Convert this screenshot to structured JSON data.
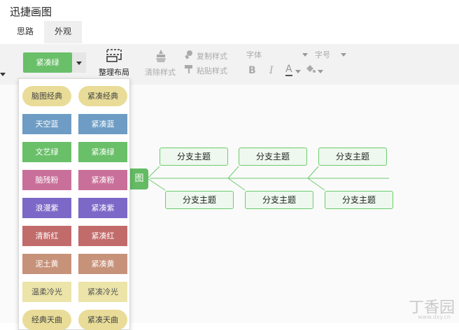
{
  "app_title": "迅捷画图",
  "tabs": [
    {
      "label": "思路"
    },
    {
      "label": "外观"
    }
  ],
  "toolbar": {
    "theme_selected": "紧凑绿",
    "tidy_layout": "整理布局",
    "clear_style": "清除样式",
    "copy_style": "复制样式",
    "paste_style": "粘贴样式",
    "font_label": "字体",
    "font_size_label": "字号",
    "bold": "B",
    "italic": "I",
    "font_color": "A"
  },
  "theme_list": [
    {
      "label": "脑图经典",
      "bg": "#e8dc98",
      "fg": "#444444",
      "pill": true
    },
    {
      "label": "紧凑经典",
      "bg": "#e8dc98",
      "fg": "#444444",
      "pill": true
    },
    {
      "label": "天空蓝",
      "bg": "#6e9cc4",
      "fg": "#ffffff",
      "pill": false
    },
    {
      "label": "紧凑蓝",
      "bg": "#6e9cc4",
      "fg": "#ffffff",
      "pill": false
    },
    {
      "label": "文艺绿",
      "bg": "#6abf69",
      "fg": "#ffffff",
      "pill": false
    },
    {
      "label": "紧凑绿",
      "bg": "#6abf69",
      "fg": "#ffffff",
      "pill": false
    },
    {
      "label": "脑残粉",
      "bg": "#c9709a",
      "fg": "#ffffff",
      "pill": false
    },
    {
      "label": "紧凑粉",
      "bg": "#c9709a",
      "fg": "#ffffff",
      "pill": false
    },
    {
      "label": "浪漫紫",
      "bg": "#7b68c7",
      "fg": "#ffffff",
      "pill": false
    },
    {
      "label": "紧凑紫",
      "bg": "#7b68c7",
      "fg": "#ffffff",
      "pill": false
    },
    {
      "label": "清新红",
      "bg": "#c26b6b",
      "fg": "#ffffff",
      "pill": false
    },
    {
      "label": "紧凑红",
      "bg": "#c26b6b",
      "fg": "#ffffff",
      "pill": false
    },
    {
      "label": "泥土黄",
      "bg": "#c7927a",
      "fg": "#ffffff",
      "pill": false
    },
    {
      "label": "紧凑黄",
      "bg": "#c7927a",
      "fg": "#ffffff",
      "pill": false
    },
    {
      "label": "温柔冷光",
      "bg": "#ece4a8",
      "fg": "#555555",
      "pill": false
    },
    {
      "label": "紧凑冷光",
      "bg": "#ece4a8",
      "fg": "#555555",
      "pill": false
    },
    {
      "label": "经典天曲",
      "bg": "#e8dc98",
      "fg": "#444444",
      "pill": true
    },
    {
      "label": "紧凑天曲",
      "bg": "#e8dc98",
      "fg": "#444444",
      "pill": true
    }
  ],
  "mindmap": {
    "root_label": "图",
    "branches": [
      {
        "label": "分支主题"
      },
      {
        "label": "分支主题"
      },
      {
        "label": "分支主题"
      },
      {
        "label": "分支主题"
      },
      {
        "label": "分支主题"
      },
      {
        "label": "分支主题"
      }
    ]
  },
  "watermark": {
    "main": "丁香园",
    "sub": "www.dxy.cn"
  },
  "colors": {
    "accent_green": "#6abf69",
    "node_border": "#6ecb6e",
    "node_fill": "#eef8ee"
  }
}
